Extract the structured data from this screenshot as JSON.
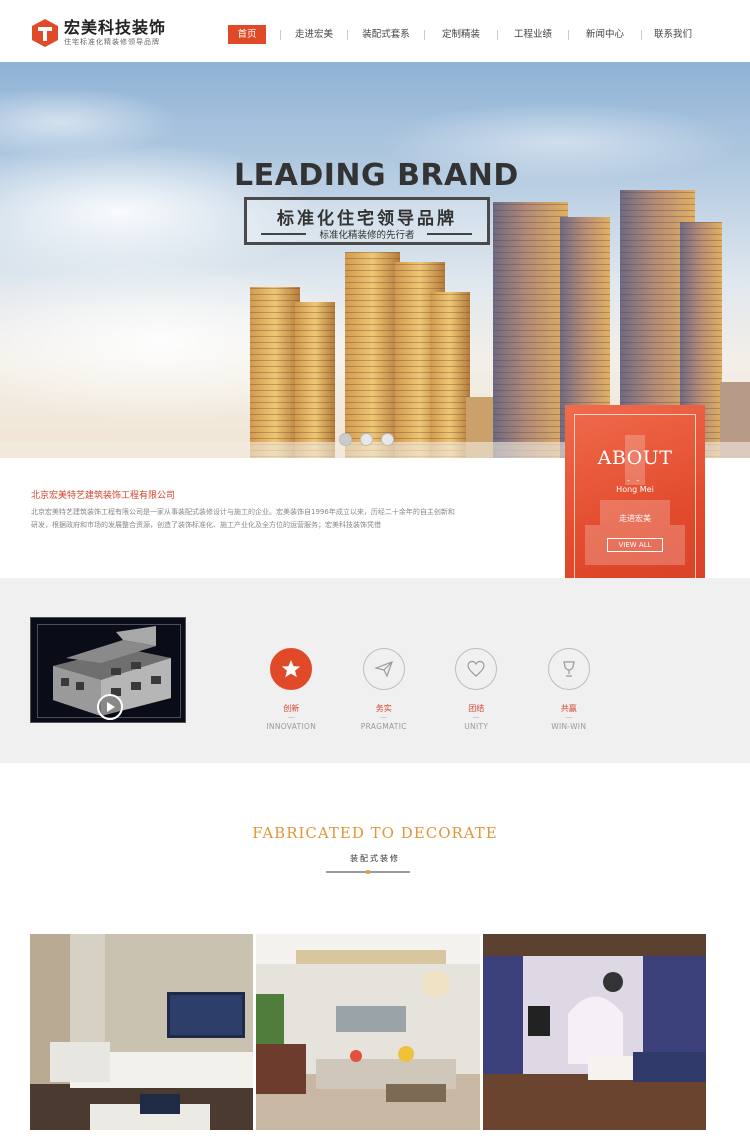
{
  "header": {
    "logo_title": "宏美科技装饰",
    "logo_subtitle": "住宅标准化精装修领导品牌",
    "nav": [
      "首页",
      "走进宏美",
      "装配式套系",
      "定制精装",
      "工程业绩",
      "新闻中心",
      "联系我们"
    ],
    "active_index": 0
  },
  "banner": {
    "headline": "LEADING BRAND",
    "box_title": "标准化住宅领导品牌",
    "box_subtitle": "标准化精装修的先行者",
    "slides": 3,
    "active_slide": 0
  },
  "about": {
    "company": "北京宏美特艺建筑装饰工程有限公司",
    "text": "北京宏美特艺建筑装饰工程有限公司是一家从事装配式装修设计与施工的企业。宏美装饰自1996年成立以来，历经二十余年的自主创新和研发，根据政府和市场的发展整合资源，创造了装饰标准化、施工产业化及全方位的运营服务；宏美科技装饰凭借",
    "card": {
      "title": "ABOUT",
      "dash": "- -",
      "english": "Hong Mei",
      "chinese": "走进宏美",
      "button": "VIEW ALL"
    }
  },
  "values": [
    {
      "cn": "创新",
      "dash": "—",
      "en": "INNOVATION",
      "icon": "star-icon"
    },
    {
      "cn": "务实",
      "dash": "—",
      "en": "PRAGMATIC",
      "icon": "paper-plane-icon"
    },
    {
      "cn": "团结",
      "dash": "—",
      "en": "UNITY",
      "icon": "heart-icon"
    },
    {
      "cn": "共赢",
      "dash": "—",
      "en": "WIN-WIN",
      "icon": "trophy-icon"
    }
  ],
  "fabricated": {
    "title": "FABRICATED  TO DECORATE",
    "subtitle": "装配式装修"
  },
  "colors": {
    "accent": "#e04a28",
    "gold": "#e39638"
  }
}
